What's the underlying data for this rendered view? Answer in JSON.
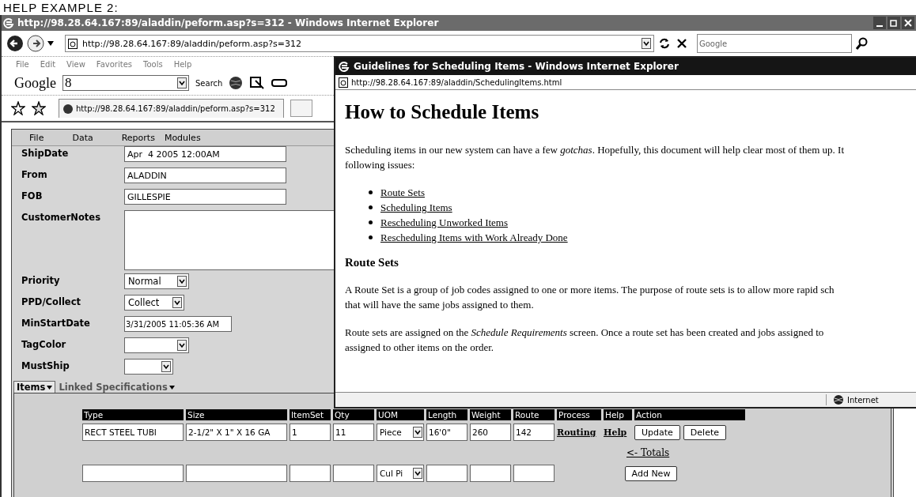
{
  "page_heading": "HELP EXAMPLE 2:",
  "main_window": {
    "title": "http://98.28.64.167:89/aladdin/peform.asp?s=312 - Windows Internet Explorer",
    "address": "http://98.28.64.167:89/aladdin/peform.asp?s=312",
    "search_placeholder": "Google",
    "menu": [
      "File",
      "Edit",
      "View",
      "Favorites",
      "Tools",
      "Help"
    ],
    "google_toolbar": {
      "brand": "Google",
      "field_value": "8",
      "search_label": "Search"
    },
    "tab_url": "http://98.28.64.167:89/aladdin/peform.asp?s=312"
  },
  "app": {
    "menu": [
      "File",
      "Data",
      "Reports",
      "Modules"
    ],
    "fields": [
      {
        "label": "ShipDate",
        "kind": "text",
        "value": "Apr  4 2005 12:00AM"
      },
      {
        "label": "From",
        "kind": "text",
        "value": "ALADDIN"
      },
      {
        "label": "FOB",
        "kind": "text",
        "value": "GILLESPIE"
      },
      {
        "label": "CustomerNotes",
        "kind": "textarea"
      },
      {
        "label": "Priority",
        "kind": "select",
        "value": "Normal"
      },
      {
        "label": "PPD/Collect",
        "kind": "select",
        "value": "Collect"
      },
      {
        "label": "MinStartDate",
        "kind": "date",
        "value": "3/31/2005 11:05:36 AM"
      },
      {
        "label": "TagColor",
        "kind": "select"
      },
      {
        "label": "MustShip",
        "kind": "select"
      }
    ],
    "tabs": [
      {
        "label": "Items",
        "selected": true
      },
      {
        "label": "Linked Specifications",
        "selected": false
      }
    ],
    "items_table": {
      "columns": [
        "Type",
        "Size",
        "ItemSet",
        "Qty",
        "UOM",
        "Length",
        "Weight",
        "Route",
        "Process",
        "Help",
        "Action"
      ],
      "rows": [
        {
          "type": "RECT STEEL TUBI",
          "size": "2-1/2\" X 1\" X 16 GA",
          "item_set": "1",
          "qty": "11",
          "uom": "Piece",
          "length": "16'0\"",
          "weight": "260",
          "route": "142",
          "process_link": "Routing",
          "help_link": "Help",
          "actions": [
            "Update",
            "Delete"
          ]
        }
      ],
      "totals_link": "<- Totals",
      "new_row": {
        "uom": "Cul Pi",
        "add_button": "Add New"
      }
    }
  },
  "popup": {
    "title": "Guidelines for Scheduling Items - Windows Internet Explorer",
    "address": "http://98.28.64.167:89/aladdin/SchedulingItems.html",
    "heading": "How to Schedule Items",
    "intro_lines": [
      "Scheduling items in our new system can have a few *gotchas*. Hopefully, this document will help clear most of them up. It",
      "following issues:"
    ],
    "links": [
      "Route Sets",
      "Scheduling Items",
      "Rescheduling Unworked Items",
      "Rescheduling Items with Work Already Done"
    ],
    "section_heading": "Route Sets",
    "paragraphs": [
      [
        "A Route Set is a group of job codes assigned to one or more items. The purpose of route sets is to allow more rapid sch",
        "that will have the same jobs assigned to them."
      ],
      [
        "Route sets are assigned on the *Schedule Requirements* screen. Once a route set has been created and jobs assigned to",
        "assigned to other items on the order."
      ]
    ],
    "status_zone": "Internet"
  }
}
